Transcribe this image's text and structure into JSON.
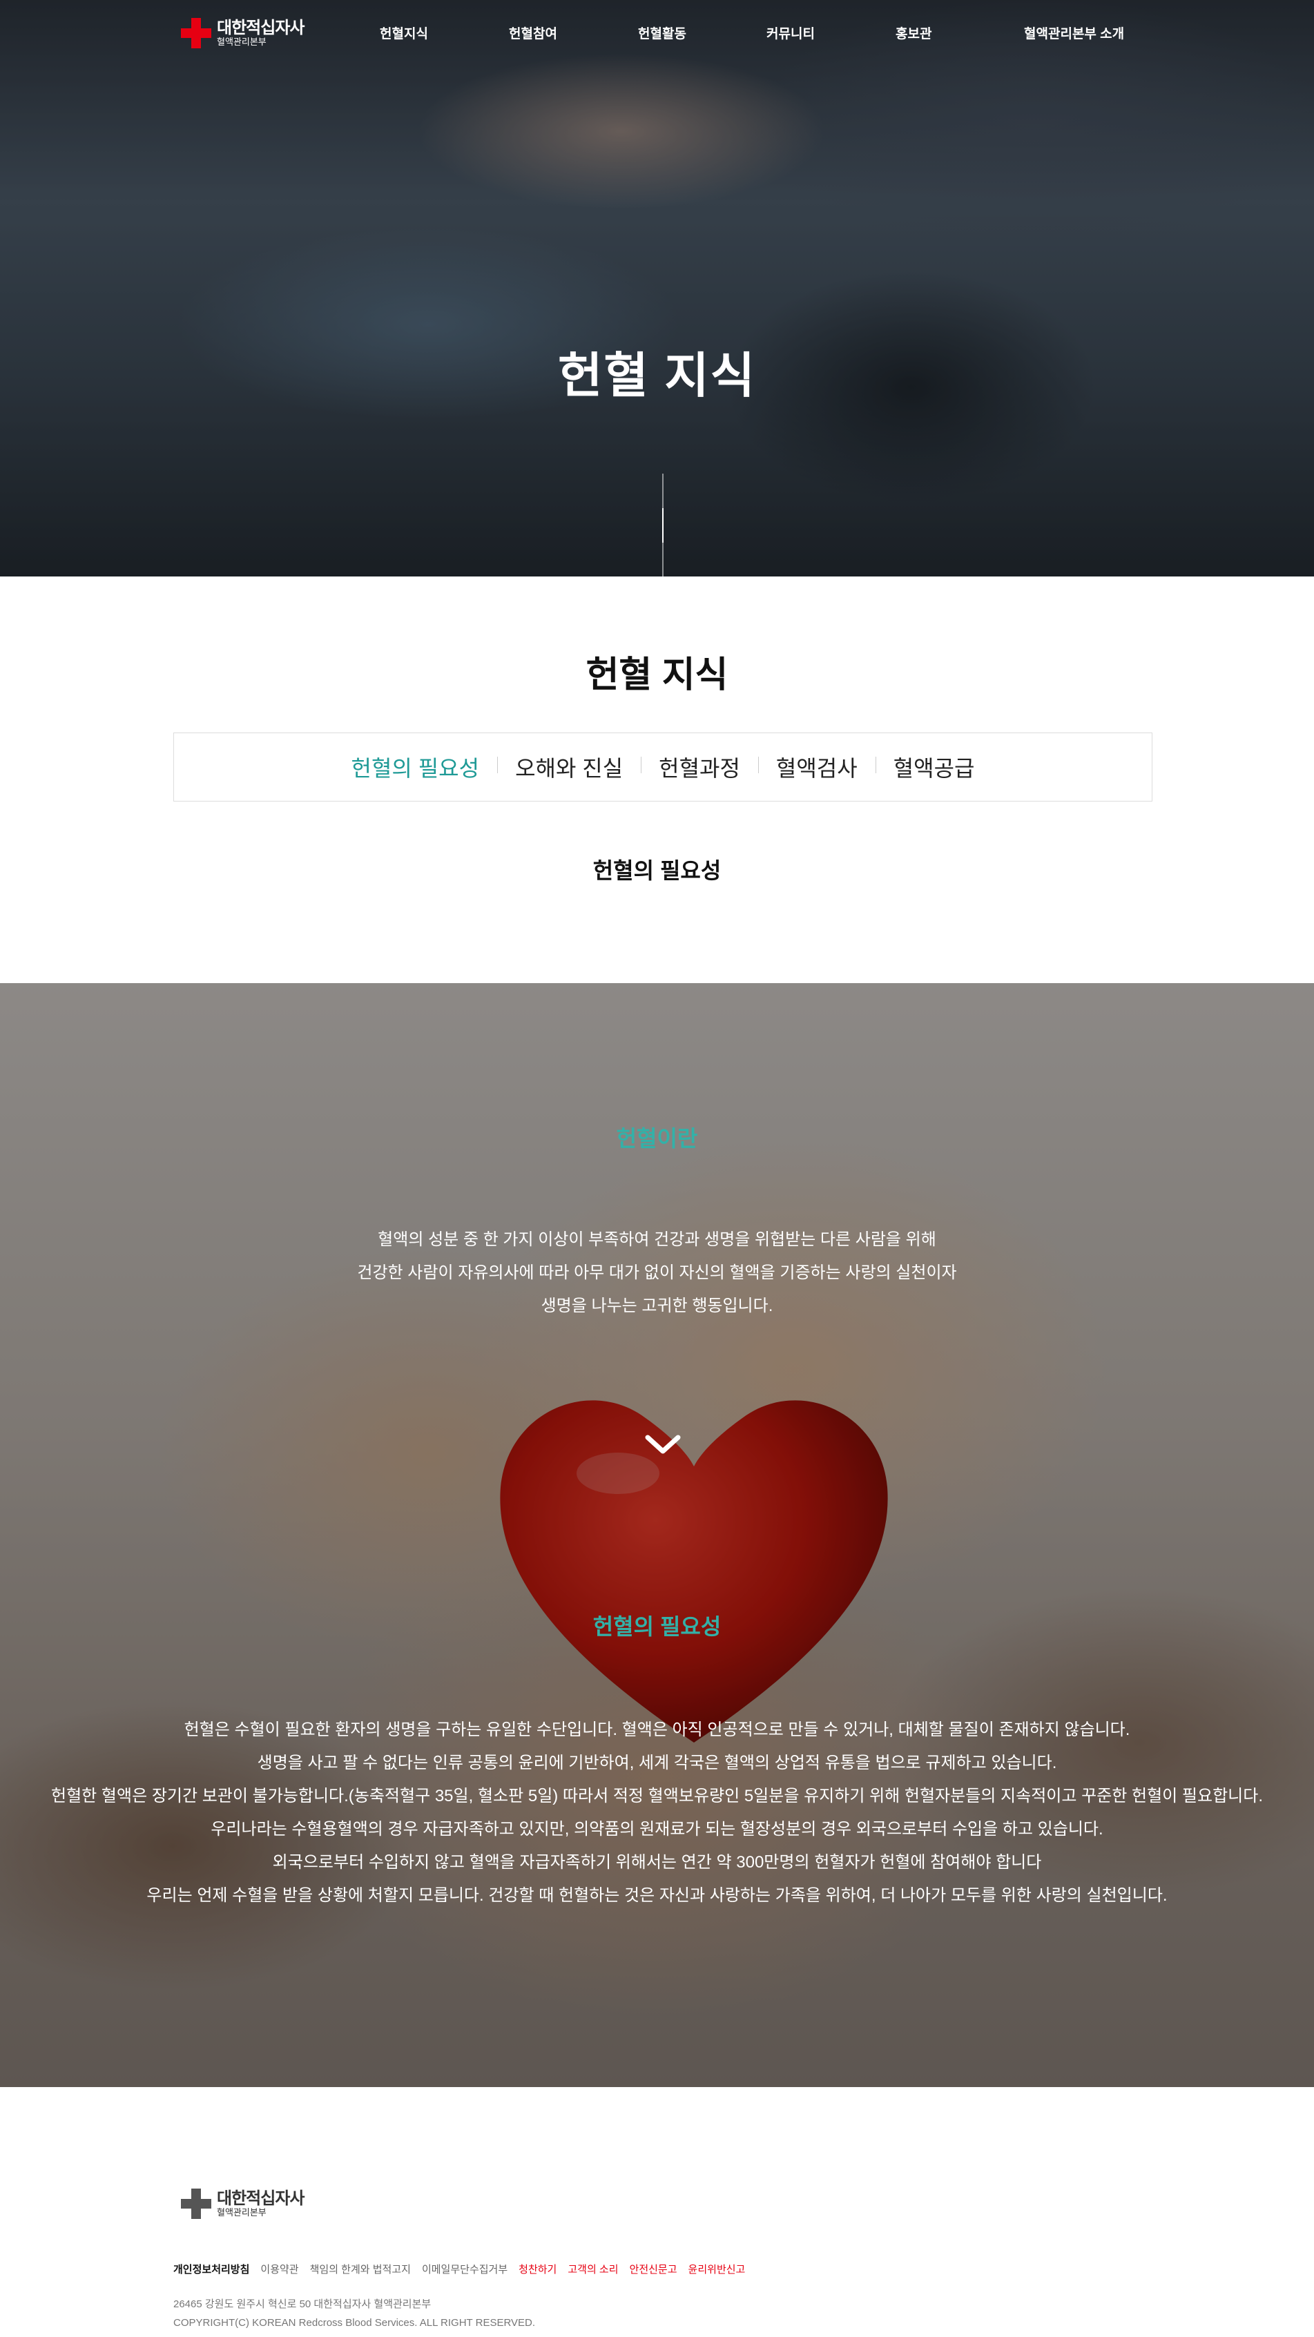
{
  "header": {
    "logo": {
      "main": "대한적십자사",
      "sub": "혈액관리본부"
    },
    "nav": [
      "헌혈지식",
      "헌혈참여",
      "헌혈활동",
      "커뮤니티",
      "홍보관",
      "혈액관리본부 소개"
    ]
  },
  "hero": {
    "title": "헌혈 지식"
  },
  "section": {
    "title": "헌혈 지식",
    "tabs": [
      "헌혈의 필요성",
      "오해와 진실",
      "헌혈과정",
      "혈액검사",
      "혈액공급"
    ],
    "active_tab": 0,
    "subtitle": "헌혈의 필요성"
  },
  "about": {
    "title": "헌혈이란",
    "lines": [
      "혈액의 성분 중 한 가지 이상이 부족하여 건강과 생명을 위협받는 다른 사람을 위해",
      "건강한 사람이 자유의사에 따라 아무 대가 없이 자신의 혈액을 기증하는 사랑의 실천이자",
      "생명을 나누는 고귀한 행동입니다."
    ]
  },
  "necessity": {
    "title": "헌혈의 필요성",
    "lines": [
      "헌혈은 수혈이 필요한 환자의 생명을 구하는 유일한 수단입니다. 혈액은 아직 인공적으로 만들 수 있거나, 대체할 물질이 존재하지 않습니다.",
      "생명을 사고 팔 수 없다는 인류 공통의 윤리에 기반하여, 세계 각국은 혈액의 상업적 유통을 법으로 규제하고 있습니다.",
      "헌혈한 혈액은 장기간 보관이 불가능합니다.(농축적혈구 35일, 혈소판 5일) 따라서 적정 혈액보유량인 5일분을 유지하기 위해 헌혈자분들의 지속적이고 꾸준한 헌혈이 필요합니다.",
      "우리나라는 수혈용혈액의 경우 자급자족하고 있지만, 의약품의 원재료가 되는 혈장성분의 경우 외국으로부터 수입을 하고 있습니다.",
      "외국으로부터 수입하지 않고 혈액을 자급자족하기 위해서는 연간 약 300만명의 헌혈자가 헌혈에 참여해야 합니다",
      "우리는 언제 수혈을 받을 상황에 처할지 모릅니다. 건강할 때 헌혈하는 것은 자신과 사랑하는 가족을 위하여, 더 나아가 모두를 위한 사랑의 실천입니다."
    ]
  },
  "footer": {
    "logo": {
      "main": "대한적십자사",
      "sub": "혈액관리본부"
    },
    "links": [
      {
        "label": "개인정보처리방침",
        "style": "bold"
      },
      {
        "label": "이용약관",
        "style": "normal"
      },
      {
        "label": "책임의 한계와 법적고지",
        "style": "normal"
      },
      {
        "label": "이메일무단수집거부",
        "style": "normal"
      },
      {
        "label": "청찬하기",
        "style": "red"
      },
      {
        "label": "고객의 소리",
        "style": "red"
      },
      {
        "label": "안전신문고",
        "style": "red"
      },
      {
        "label": "윤리위반신고",
        "style": "red"
      }
    ],
    "address": "26465 강원도 원주시 혁신로 50 대한적십자사 혈액관리본부",
    "copyright": "COPYRIGHT(C) KOREAN Redcross Blood Services. ALL RIGHT RESERVED."
  },
  "colors": {
    "brand_red": "#e60012",
    "accent_teal": "#1e9a96",
    "heading_teal": "#33b1a8"
  }
}
